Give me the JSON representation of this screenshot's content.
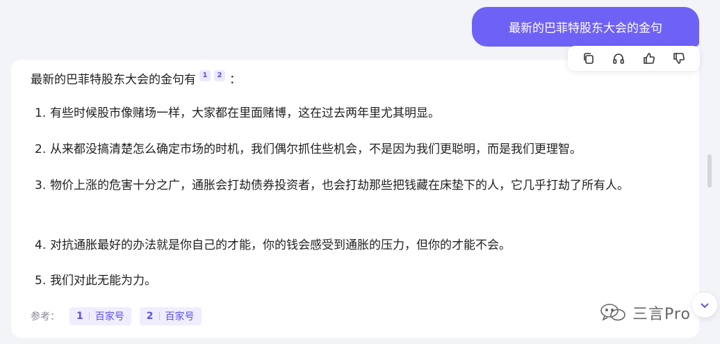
{
  "user_message": "最新的巴菲特股东大会的金句",
  "message_actions": {
    "copy": "copy-icon",
    "listen": "headphones-icon",
    "like": "thumbs-up-icon",
    "dislike": "thumbs-down-icon"
  },
  "answer": {
    "intro": "最新的巴菲特股东大会的金句有",
    "citations": [
      "1",
      "2"
    ],
    "colon": "：",
    "items": [
      {
        "num": "1.",
        "text": "有些时候股市像赌场一样，大家都在里面赌博，这在过去两年里尤其明显。"
      },
      {
        "num": "2.",
        "text": "从来都没搞清楚怎么确定市场的时机，我们偶尔抓住些机会，不是因为我们更聪明，而是我们更理智。"
      },
      {
        "num": "3.",
        "text": "物价上涨的危害十分之广，通胀会打劫债券投资者，也会打劫那些把钱藏在床垫下的人，它几乎打劫了所有人。"
      },
      {
        "num": "4.",
        "text": "对抗通胀最好的办法就是你自己的才能，你的钱会感受到通胀的压力，但你的才能不会。"
      },
      {
        "num": "5.",
        "text": "我们对此无能为力。"
      }
    ]
  },
  "references": {
    "label": "参考：",
    "items": [
      {
        "num": "1",
        "source": "百家号"
      },
      {
        "num": "2",
        "source": "百家号"
      }
    ]
  },
  "watermark": {
    "brand": "三言Pro"
  },
  "colors": {
    "accent": "#6e62f6",
    "background": "#f3f4f8",
    "citation_bg": "#ebe9ff"
  }
}
